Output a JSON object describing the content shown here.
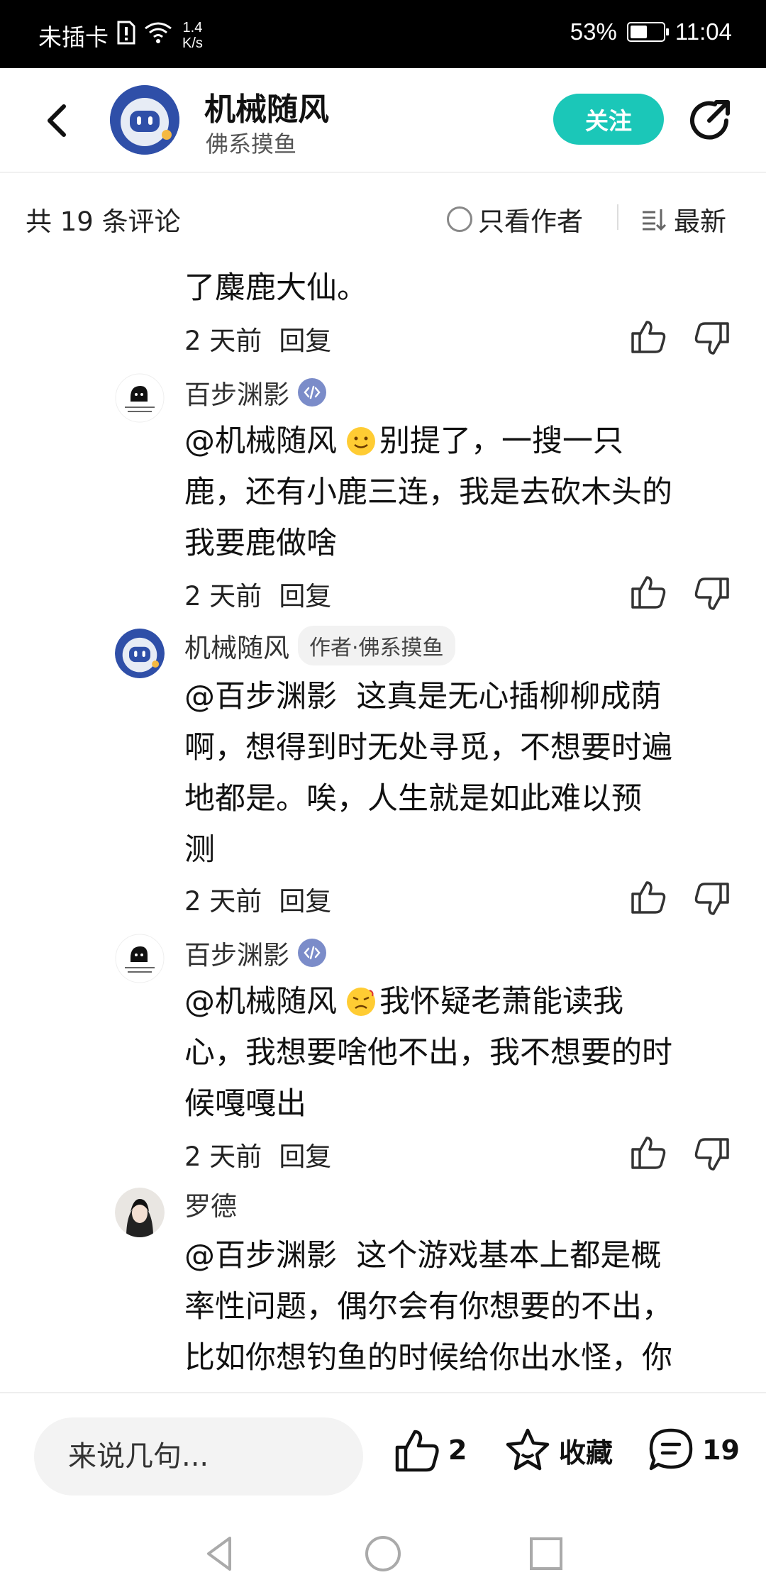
{
  "status_bar": {
    "carrier": "未插卡",
    "net_speed_value": "1.4",
    "net_speed_unit": "K/s",
    "battery": "53%",
    "battery_level": 0.53,
    "time": "11:04"
  },
  "header": {
    "author_name": "机械随风",
    "author_subtitle": "佛系摸鱼",
    "follow_label": "关注"
  },
  "subheader": {
    "count_label": "共 19 条评论",
    "author_only_label": "只看作者",
    "sort_label": "最新"
  },
  "comments": [
    {
      "text_lines": [
        "了麋鹿大仙。"
      ],
      "time": "2 天前",
      "reply_label": "回复"
    },
    {
      "name": "百步渊影",
      "mention": "@机械随风",
      "text_first": "别提了，一搜一只",
      "text_rest": [
        "鹿，还有小鹿三连，我是去砍木头的",
        "我要鹿做啥"
      ],
      "emoji": "smile-emoji",
      "time": "2 天前",
      "reply_label": "回复"
    },
    {
      "name": "机械随风",
      "badge": "作者·佛系摸鱼",
      "mention": "@百步渊影",
      "text_first": "这真是无心插柳柳成荫",
      "text_rest": [
        "啊，想得到时无处寻觅，不想要时遍",
        "地都是。唉，人生就是如此难以预",
        "测"
      ],
      "time": "2 天前",
      "reply_label": "回复"
    },
    {
      "name": "百步渊影",
      "mention": "@机械随风",
      "text_first": "我怀疑老萧能读我",
      "text_rest": [
        "心，我想要啥他不出，我不想要的时",
        "候嘎嘎出"
      ],
      "emoji": "frustrated-emoji",
      "time": "2 天前",
      "reply_label": "回复"
    },
    {
      "name": "罗德",
      "mention": "@百步渊影",
      "text_first": "这个游戏基本上都是概",
      "text_rest": [
        "率性问题，偶尔会有你想要的不出，",
        "比如你想钓鱼的时候给你出水怪，你"
      ]
    }
  ],
  "bottom_bar": {
    "input_placeholder": "来说几句...",
    "like_count": "2",
    "favorite_label": "收藏",
    "comment_count": "19"
  },
  "colors": {
    "accent": "#1bc7b8",
    "status_bar_bg": "#000000"
  }
}
